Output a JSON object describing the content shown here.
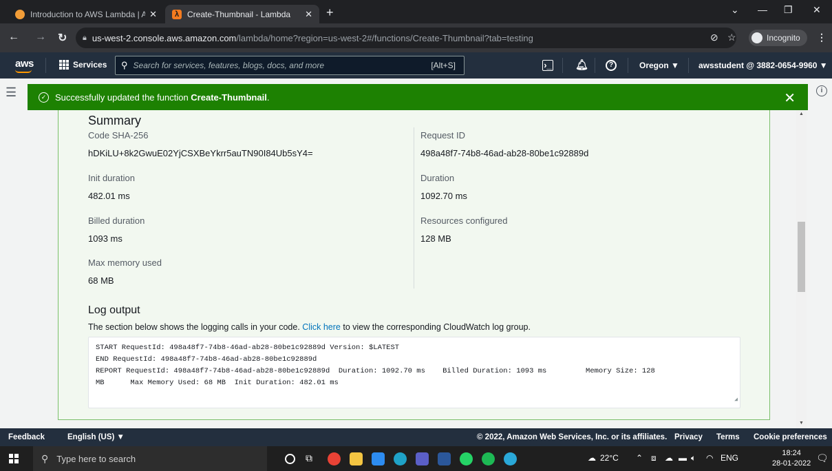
{
  "browser": {
    "tabs": [
      {
        "title": "Introduction to AWS Lambda | A",
        "icon": "aws-academy-icon",
        "icon_color": "#f29d38"
      },
      {
        "title": "Create-Thumbnail - Lambda",
        "icon": "lambda-icon",
        "icon_color": "#f47b1f"
      }
    ],
    "new_tab": "+",
    "url_host": "us-west-2.console.aws.amazon.com",
    "url_path": "/lambda/home?region=us-west-2#/functions/Create-Thumbnail?tab=testing",
    "incognito_label": "Incognito"
  },
  "aws_nav": {
    "logo": "aws",
    "services_label": "Services",
    "search_placeholder": "Search for services, features, blogs, docs, and more",
    "search_shortcut": "[Alt+S]",
    "region": "Oregon ▼",
    "account": "awsstudent @ 3882-0654-9960 ▼"
  },
  "flash": {
    "prefix": "Successfully updated the function ",
    "function_name": "Create-Thumbnail",
    "suffix": ".",
    "color": "#1d8102"
  },
  "summary": {
    "title": "Summary",
    "fields": {
      "code_sha_label": "Code SHA-256",
      "code_sha_value": "hDKiLU+8k2GwuE02YjCSXBeYkrr5auTN90I84Ub5sY4=",
      "request_id_label": "Request ID",
      "request_id_value": "498a48f7-74b8-46ad-ab28-80be1c92889d",
      "init_duration_label": "Init duration",
      "init_duration_value": "482.01 ms",
      "duration_label": "Duration",
      "duration_value": "1092.70 ms",
      "billed_duration_label": "Billed duration",
      "billed_duration_value": "1093 ms",
      "resources_label": "Resources configured",
      "resources_value": "128 MB",
      "max_memory_label": "Max memory used",
      "max_memory_value": "68 MB"
    }
  },
  "log": {
    "title": "Log output",
    "desc_prefix": "The section below shows the logging calls in your code. ",
    "desc_link": "Click here",
    "desc_suffix": " to view the corresponding CloudWatch log group.",
    "lines": "START RequestId: 498a48f7-74b8-46ad-ab28-80be1c92889d Version: $LATEST\nEND RequestId: 498a48f7-74b8-46ad-ab28-80be1c92889d\nREPORT RequestId: 498a48f7-74b8-46ad-ab28-80be1c92889d  Duration: 1092.70 ms    Billed Duration: 1093 ms         Memory Size: 128\nMB      Max Memory Used: 68 MB  Init Duration: 482.01 ms"
  },
  "footer": {
    "feedback": "Feedback",
    "language": "English (US) ▼",
    "copyright": "© 2022, Amazon Web Services, Inc. or its affiliates.",
    "privacy": "Privacy",
    "terms": "Terms",
    "cookies": "Cookie preferences"
  },
  "taskbar": {
    "search_placeholder": "Type here to search",
    "weather": "22°C",
    "language": "ENG",
    "time": "18:24",
    "date": "28-01-2022"
  }
}
